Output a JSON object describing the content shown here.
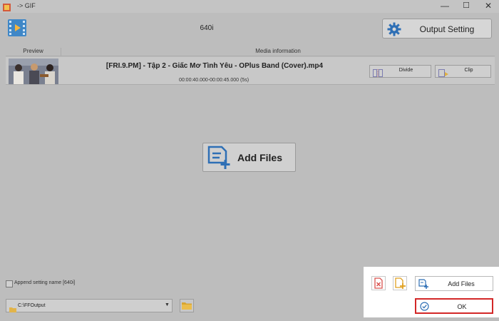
{
  "window": {
    "title": "-> GIF",
    "minimize_glyph": "—",
    "maximize_glyph": "☐",
    "close_glyph": "✕"
  },
  "header": {
    "resolution": "640i",
    "output_setting_label": "Output Setting"
  },
  "file_list": {
    "columns": [
      "Preview",
      "Media information"
    ],
    "items": [
      {
        "name": "[FRI.9.PM] - Tập 2 - Giấc Mơ Tình Yêu - OPlus Band (Cover).mp4",
        "duration": "00:00:40.000-00:00:45.000 (5s)",
        "divide_label": "Divide",
        "clip_label": "Clip"
      }
    ]
  },
  "center": {
    "add_files_label": "Add Files"
  },
  "footer": {
    "append_label": "Append setting name [640i]",
    "append_checked": false,
    "output_folder": "C:\\FFOutput"
  },
  "popup": {
    "add_files_label": "Add Files",
    "ok_label": "OK"
  },
  "icons": {
    "app": "app-logo-icon",
    "header": "video-file-icon",
    "output": "gear-icon",
    "add_files": "add-file-icon",
    "ok": "check-circle-icon"
  },
  "colors": {
    "accent_blue": "#2e6fb5",
    "highlight_red": "#d32727",
    "overlay_gray": "#bdbdbd"
  }
}
